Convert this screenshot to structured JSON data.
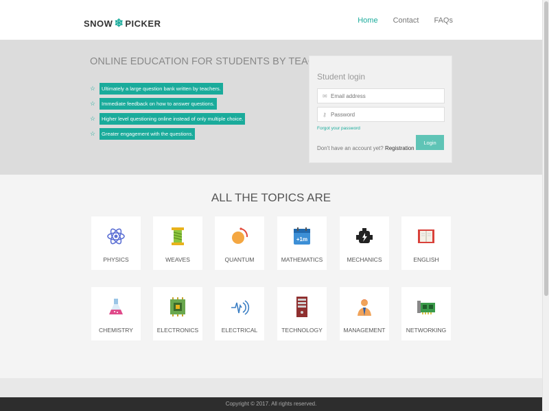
{
  "brand": {
    "left": "SNOW",
    "right": "PICKER"
  },
  "nav": {
    "items": [
      {
        "label": "Home",
        "active": true
      },
      {
        "label": "Contact",
        "active": false
      },
      {
        "label": "FAQs",
        "active": false
      }
    ]
  },
  "hero": {
    "title": "ONLINE EDUCATION FOR STUDENTS BY TEACHERS",
    "features": [
      "Ultimately a large question bank written by teachers.",
      "Immediate feedback on how to answer questions.",
      "Higher level questioning online instead of only multiple choice.",
      "Greater engagement with the questions."
    ]
  },
  "login": {
    "title": "Student login",
    "email_placeholder": "Email address",
    "password_placeholder": "Password",
    "forgot": "Forgot your password",
    "no_account": "Don't have an account yet?",
    "register": "Registration",
    "button": "Login"
  },
  "topics": {
    "title": "ALL THE TOPICS ARE",
    "items": [
      {
        "label": "PHYSICS",
        "icon": "atom-icon"
      },
      {
        "label": "WEAVES",
        "icon": "spool-icon"
      },
      {
        "label": "QUANTUM",
        "icon": "quantum-icon"
      },
      {
        "label": "MATHEMATICS",
        "icon": "calendar-plus-icon",
        "icon_text": "+1m"
      },
      {
        "label": "MECHANICS",
        "icon": "engine-icon"
      },
      {
        "label": "ENGLISH",
        "icon": "book-icon"
      },
      {
        "label": "CHEMISTRY",
        "icon": "flask-icon"
      },
      {
        "label": "ELECTRONICS",
        "icon": "chip-icon"
      },
      {
        "label": "ELECTRICAL",
        "icon": "signal-icon"
      },
      {
        "label": "TECHNOLOGY",
        "icon": "server-icon"
      },
      {
        "label": "MANAGEMENT",
        "icon": "manager-icon"
      },
      {
        "label": "NETWORKING",
        "icon": "network-card-icon"
      }
    ]
  },
  "footer": {
    "text": "Copyright © 2017. All rights reserved."
  },
  "colors": {
    "accent": "#1aab9b",
    "hero_bg": "#dcdcdc",
    "footer_bg": "#2d2d2d"
  }
}
